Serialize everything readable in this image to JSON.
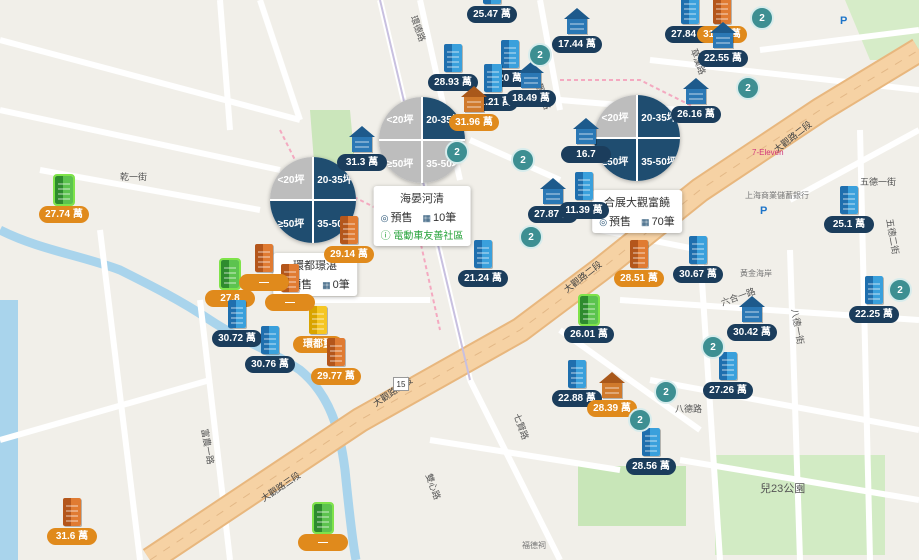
{
  "map": {
    "roads": {
      "main": "大觀路三段",
      "main2": "大觀路二段",
      "road_qianyi": "乾一街",
      "road_tsaonan": "草漢路",
      "road_guanmao": "觀一路",
      "road_qi": "七賢路",
      "road_jing": "雙心路",
      "road_eight": "八德路",
      "road_fu": "富農一路",
      "road_wu": "五德一街",
      "road_wu2": "五德二街",
      "road_ba": "八德一街",
      "road_liu": "六合一路",
      "road_huan": "環德路"
    },
    "route_no": "15",
    "park": "兒23公園",
    "poi_bank": "上海商業儲蓄銀行",
    "poi_711": "7-Eleven",
    "poi_temple": "福德祠",
    "poi_ctbc": "黃金海岸",
    "parking": "P"
  },
  "pins": [
    {
      "label": "25.47 萬",
      "kind": "tower",
      "tag": "navy"
    },
    {
      "label": "17.44 萬",
      "kind": "house",
      "tag": "navy"
    },
    {
      "label": "27.84 萬",
      "kind": "tower",
      "tag": "navy"
    },
    {
      "label": "31.26 萬",
      "kind": "orange",
      "tag": "orange"
    },
    {
      "label": "22.55 萬",
      "kind": "house",
      "tag": "navy"
    },
    {
      "label": "28.93 萬",
      "kind": "tower",
      "tag": "navy"
    },
    {
      "label": "20 萬",
      "kind": "tower",
      "tag": "navy"
    },
    {
      "label": "21.21 萬",
      "kind": "tower",
      "tag": "navy"
    },
    {
      "label": "18.49 萬",
      "kind": "house",
      "tag": "navy"
    },
    {
      "label": "31.96 萬",
      "kind": "house_o",
      "tag": "orange"
    },
    {
      "label": "26.16 萬",
      "kind": "house",
      "tag": "navy"
    },
    {
      "label": "31.3 萬",
      "kind": "house",
      "tag": "navy"
    },
    {
      "label": "16.7",
      "kind": "house",
      "tag": "navy"
    },
    {
      "label": "27.74 萬",
      "kind": "green",
      "tag": "orange"
    },
    {
      "label": "27.87 萬",
      "kind": "house",
      "tag": "navy"
    },
    {
      "label": "11.39 萬",
      "kind": "tower",
      "tag": "navy"
    },
    {
      "label": "25.1 萬",
      "kind": "tower",
      "tag": "navy"
    },
    {
      "label": "29.14 萬",
      "kind": "orange",
      "tag": "orange"
    },
    {
      "label": "21.24 萬",
      "kind": "tower",
      "tag": "navy"
    },
    {
      "label": "28.51 萬",
      "kind": "orange",
      "tag": "orange"
    },
    {
      "label": "30.67 萬",
      "kind": "tower",
      "tag": "navy"
    },
    {
      "label": "22.25 萬",
      "kind": "tower",
      "tag": "navy"
    },
    {
      "label": "27.8",
      "kind": "green",
      "tag": "orange"
    },
    {
      "label": "30.72 萬",
      "kind": "tower",
      "tag": "navy"
    },
    {
      "label": "30.76 萬",
      "kind": "tower",
      "tag": "navy"
    },
    {
      "label": "環都璽",
      "kind": "yellow",
      "tag": "orange"
    },
    {
      "label": "29.77 萬",
      "kind": "orange",
      "tag": "orange"
    },
    {
      "label": "26.01 萬",
      "kind": "green",
      "tag": "navy"
    },
    {
      "label": "30.42 萬",
      "kind": "house",
      "tag": "navy"
    },
    {
      "label": "27.26 萬",
      "kind": "tower",
      "tag": "navy"
    },
    {
      "label": "22.88 萬",
      "kind": "tower",
      "tag": "navy"
    },
    {
      "label": "28.39 萬",
      "kind": "house_o",
      "tag": "orange"
    },
    {
      "label": "28.56 萬",
      "kind": "tower",
      "tag": "navy"
    },
    {
      "label": "31.6 萬",
      "kind": "orange",
      "tag": "orange"
    },
    {
      "label": "—",
      "kind": "orange",
      "tag": "orange"
    },
    {
      "label": "—",
      "kind": "green",
      "tag": "orange"
    },
    {
      "label": "—",
      "kind": "orange",
      "tag": "orange"
    }
  ],
  "clusters": [
    "2",
    "2",
    "2",
    "2",
    "2",
    "2",
    "2",
    "2",
    "2",
    "2"
  ],
  "pies": [
    {
      "q": [
        "<20坪",
        "20-35坪",
        "≥50坪",
        "35-50坪"
      ],
      "on": [
        false,
        true,
        true,
        true
      ]
    },
    {
      "q": [
        "<20坪",
        "20-35坪",
        "≥50坪",
        "35-50坪"
      ],
      "on": [
        false,
        true,
        false,
        false
      ]
    },
    {
      "q": [
        "<20坪",
        "20-35坪",
        "≥50坪",
        "35-50坪"
      ],
      "on": [
        false,
        true,
        true,
        true
      ]
    }
  ],
  "cards": [
    {
      "title": "海晏河清",
      "status": "預售",
      "units": "10筆",
      "green": "電動車友善社區"
    },
    {
      "title": "合展大觀富饒",
      "status": "預售",
      "units": "70筆",
      "green": ""
    },
    {
      "title": "環都璟湛",
      "status": "預售",
      "units": "0筆",
      "green": ""
    }
  ],
  "colors": {
    "pie_on": "#1f4d70",
    "pie_off": "#bdbdbd",
    "cluster": "#3d8f92",
    "road": "#f6d2a4",
    "park": "#c8e6b8",
    "river": "#a9d4ec"
  }
}
